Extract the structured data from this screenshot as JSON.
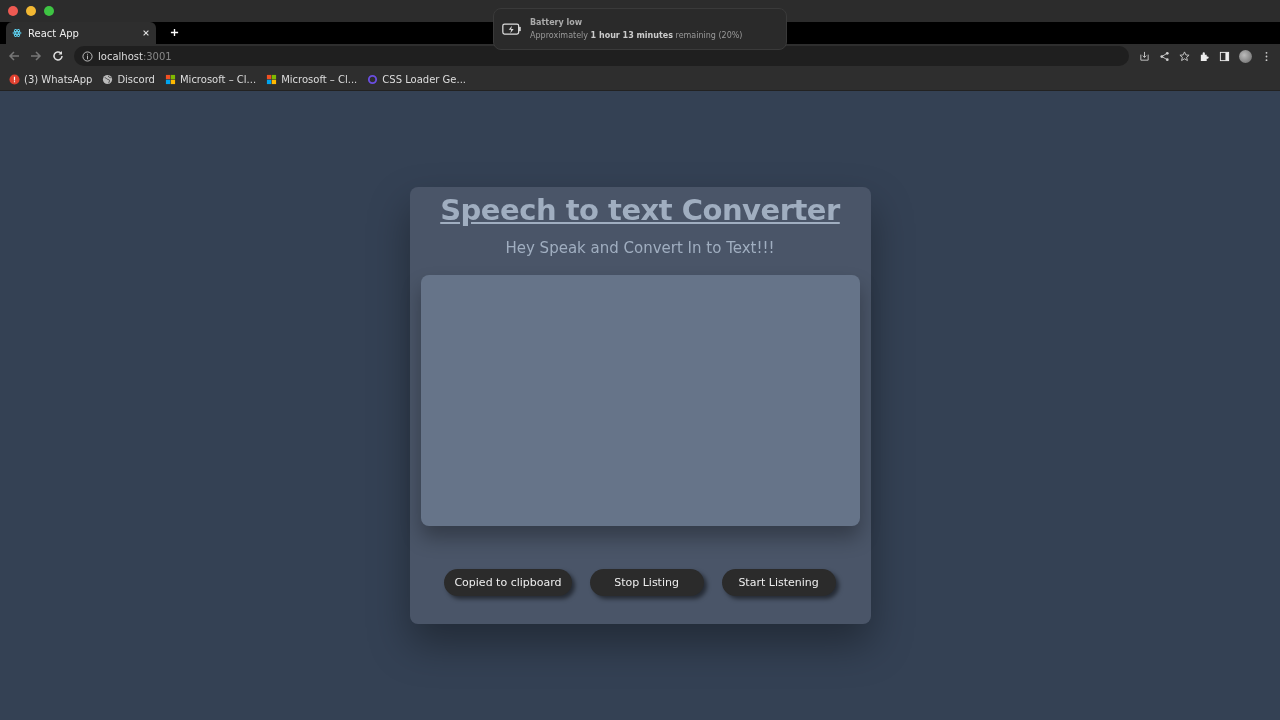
{
  "browser": {
    "tabs": [
      {
        "label": "React App",
        "selected": true
      }
    ],
    "address": {
      "host": "localhost",
      "port": ":3001"
    },
    "bookmarks": [
      {
        "label": "(3) WhatsApp",
        "kind": "alert"
      },
      {
        "label": "Discord",
        "kind": "globe"
      },
      {
        "label": "Microsoft – Cl...",
        "kind": "windows"
      },
      {
        "label": "Microsoft – Cl...",
        "kind": "windows"
      },
      {
        "label": "CSS Loader Ge...",
        "kind": "ring"
      }
    ]
  },
  "notification": {
    "title": "Battery low",
    "message": "Approximately **1 hour 13 minutes** remaining (20%)"
  },
  "app": {
    "title": "Speech to text Converter",
    "subtitle": "Hey Speak and Convert In to Text!!!",
    "buttons": [
      "Copied to clipboard",
      "Stop Listing",
      "Start Listening"
    ]
  }
}
